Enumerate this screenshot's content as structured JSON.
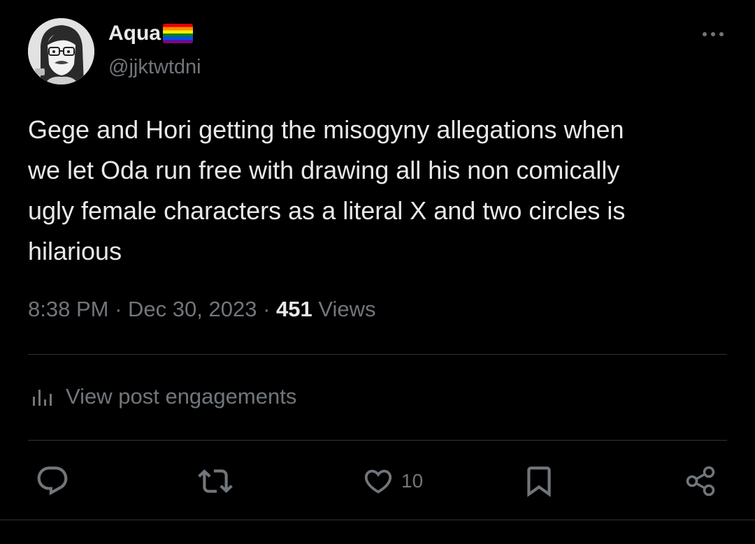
{
  "author": {
    "display_name": "Aqua",
    "handle": "@jjktwtdni",
    "flag_colors": [
      "#e40303",
      "#ff8c00",
      "#ffed00",
      "#008026",
      "#004dff",
      "#750787"
    ]
  },
  "tweet": {
    "text": "Gege and Hori getting the misogyny allegations when\nwe let Oda run free with drawing all his non comically\nugly female characters as a literal X and two circles is\nhilarious"
  },
  "meta": {
    "time": "8:38 PM",
    "separator": "·",
    "date": "Dec 30, 2023",
    "views_count": "451",
    "views_label": "Views"
  },
  "engagements": {
    "label": "View post engagements",
    "icon": "bar-chart-icon"
  },
  "actions": {
    "reply_icon": "reply-icon",
    "retweet_icon": "retweet-icon",
    "like_icon": "heart-icon",
    "like_count": "10",
    "bookmark_icon": "bookmark-icon",
    "share_icon": "share-icon"
  },
  "colors": {
    "background": "#000000",
    "primary_text": "#e7e9ea",
    "secondary_text": "#71767b",
    "divider": "#2f3336"
  }
}
